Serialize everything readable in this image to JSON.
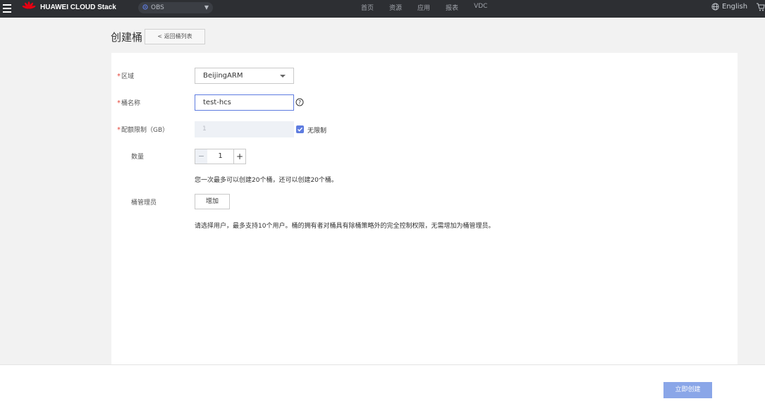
{
  "header": {
    "brand": "HUAWEI CLOUD Stack",
    "service": "OBS",
    "nav": [
      "首页",
      "资源",
      "应用",
      "报表",
      "VDC"
    ],
    "language": "English"
  },
  "page": {
    "title": "创建桶",
    "back_label": "返回桶列表"
  },
  "form": {
    "region": {
      "label": "区域",
      "value": "BeijingARM"
    },
    "bucket_name": {
      "label": "桶名称",
      "value": "test-hcs"
    },
    "quota": {
      "label": "配额限制（GB）",
      "value": "1",
      "unlimited_label": "无限制",
      "unlimited_checked": true
    },
    "quantity": {
      "label": "数量",
      "minus": "−",
      "value": "1",
      "plus": "+",
      "hint": "您一次最多可以创建20个桶，还可以创建20个桶。"
    },
    "admin": {
      "label": "桶管理员",
      "add_label": "增加",
      "hint": "请选择用户，最多支持10个用户。桶的拥有者对桶具有除桶策略外的完全控制权限，无需增加为桶管理员。"
    }
  },
  "footer": {
    "create_label": "立即创建"
  },
  "colors": {
    "accent": "#5e7ce0",
    "required": "#e5473b",
    "topbar": "#2d2f33",
    "button_disabled": "#8aa6e8"
  },
  "icons": [
    "menu-icon",
    "huawei-logo",
    "location-pin-icon",
    "chevron-down-icon",
    "globe-icon",
    "cart-icon",
    "chevron-left-icon",
    "help-icon",
    "checkmark-icon"
  ]
}
